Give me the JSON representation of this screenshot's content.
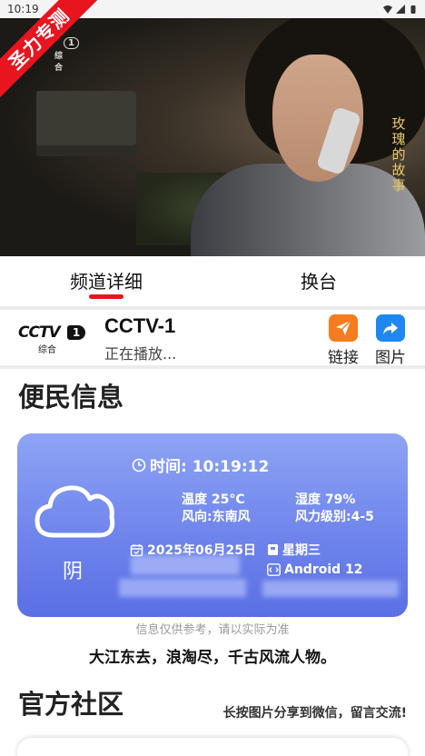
{
  "status_bar": {
    "time": "10:19"
  },
  "ribbon": {
    "text": "圣力专测"
  },
  "video": {
    "vertical_title": "玫瑰的故事",
    "logo_num": "1",
    "logo_sub": "综 合"
  },
  "tabs": [
    {
      "label": "频道详细",
      "active": true
    },
    {
      "label": "换台",
      "active": false
    }
  ],
  "channel": {
    "logo_text": "CCTV",
    "logo_num": "1",
    "logo_sub": "综合",
    "name": "CCTV-1",
    "status": "正在播放..."
  },
  "actions": [
    {
      "label": "链接",
      "icon": "send-icon",
      "color": "#f57c1f"
    },
    {
      "label": "图片",
      "icon": "share-icon",
      "color": "#1e88f0"
    }
  ],
  "section_info": {
    "title": "便民信息",
    "accent": "#2f5fe8"
  },
  "weather": {
    "time_label": "时间: 10:19:12",
    "condition": "阴",
    "temperature": "温度 25°C",
    "humidity": "湿度 79%",
    "wind_dir": "风向:东南风",
    "wind_level": "风力级别:4-5",
    "date": "2025年06月25日",
    "weekday": "星期三",
    "os": "Android 12"
  },
  "note": "信息仅供参考，请以实际为准",
  "quote": "大江东去，浪淘尽，千古风流人物。",
  "section_community": {
    "title": "官方社区",
    "accent": "#2fd35a",
    "hint": "长按图片分享到微信，留言交流!"
  }
}
